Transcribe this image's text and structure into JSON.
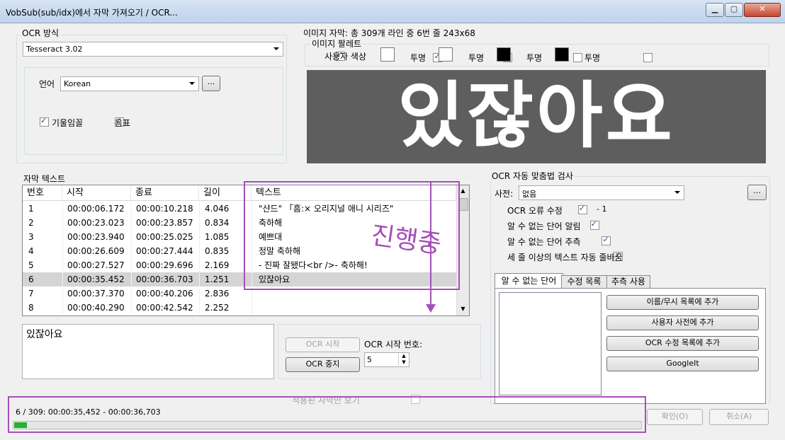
{
  "window": {
    "title": "VobSub(sub/idx)에서 자막 가져오기 / OCR..."
  },
  "ocr_method": {
    "label": "OCR 방식",
    "value": "Tesseract 3.02"
  },
  "language": {
    "label": "언어",
    "value": "Korean",
    "browse": "..."
  },
  "options": {
    "italic": "기울임꼴",
    "music": "음표"
  },
  "image": {
    "header": "이미지 자막: 총 309개 라인 중 6번 줄   243x68",
    "palette_label": "이미지 팔레트",
    "custom_colors": "사용자 색상",
    "transparent": "투명",
    "preview_text": "있잖아요",
    "swatch_colors": [
      "#ffffff",
      "#ffffff",
      "#000000",
      "#000000"
    ]
  },
  "subtitles": {
    "label": "자막 텍스트",
    "columns": [
      "번호",
      "시작",
      "종료",
      "길이",
      "텍스트"
    ],
    "rows": [
      {
        "num": "1",
        "start": "00:00:06.172",
        "end": "00:00:10.218",
        "dur": "4.046",
        "text": "\"샨드\" 「흠:× 오리지널 애니 시리즈\""
      },
      {
        "num": "2",
        "start": "00:00:23.023",
        "end": "00:00:23.857",
        "dur": "0.834",
        "text": "축하해"
      },
      {
        "num": "3",
        "start": "00:00:23.940",
        "end": "00:00:25.025",
        "dur": "1.085",
        "text": "예쁘대"
      },
      {
        "num": "4",
        "start": "00:00:26.609",
        "end": "00:00:27.444",
        "dur": "0.835",
        "text": "정말 축하해"
      },
      {
        "num": "5",
        "start": "00:00:27.527",
        "end": "00:00:29.696",
        "dur": "2.169",
        "text": "- 진짜 잘됐다<br />- 축하해!"
      },
      {
        "num": "6",
        "start": "00:00:35.452",
        "end": "00:00:36.703",
        "dur": "1.251",
        "text": "있잖아요"
      },
      {
        "num": "7",
        "start": "00:00:37.370",
        "end": "00:00:40.206",
        "dur": "2.836",
        "text": ""
      },
      {
        "num": "8",
        "start": "00:00:40.290",
        "end": "00:00:42.542",
        "dur": "2.252",
        "text": ""
      }
    ],
    "annotation": "진행중"
  },
  "current_text": "있잖아요",
  "ocr_controls": {
    "start": "OCR 시작",
    "stop": "OCR 중지",
    "start_num_label": "OCR 시작 번호:",
    "start_num": "5"
  },
  "spellcheck": {
    "label": "OCR 자동 맞춤법 검사",
    "dict_label": "사전:",
    "dict_value": "없음",
    "dict_browse": "...",
    "fix_ocr": "OCR 오류 수정",
    "fix_count": "- 1",
    "prompt_unknown": "알 수 없는 단어 알림",
    "guess_unknown": "알 수 없는 단어 추측",
    "auto_break": "세 줄 이상의 텍스트 자동 줄바꿈",
    "tabs": [
      "알 수 없는 단어",
      "수정 목록",
      "추측 사용"
    ],
    "buttons": [
      "이름/무시 목록에 추가",
      "사용자 사전에 추가",
      "OCR 수정 목록에 추가",
      "GoogleIt"
    ]
  },
  "show_applied": "적용된 자막만 보기",
  "status": {
    "text": "6 / 309: 00:00:35,452 - 00:00:36,703",
    "progress": 0.02
  },
  "footer": {
    "ok": "확인(O)",
    "cancel": "취소(A)"
  },
  "colors": {
    "accent": "#a64fb8",
    "progress": "#26b02c",
    "selection": "#d4d4d4"
  }
}
